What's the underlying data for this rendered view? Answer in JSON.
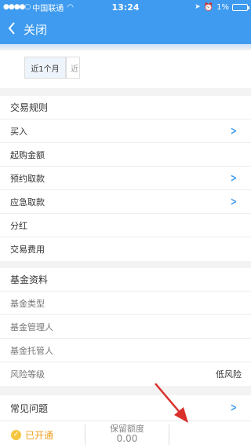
{
  "status_bar": {
    "carrier": "中国联通",
    "time": "13:24",
    "battery": "1%"
  },
  "nav": {
    "back_icon": "chevron-left-icon",
    "close_label": "关闭"
  },
  "tabs": {
    "active": "近1个月",
    "partial": "近"
  },
  "trade_rules": {
    "heading": "交易规则",
    "items": [
      {
        "label": "买入",
        "chevron": true
      },
      {
        "label": "起购金额",
        "chevron": false
      },
      {
        "label": "预约取款",
        "chevron": true
      },
      {
        "label": "应急取款",
        "chevron": true
      },
      {
        "label": "分红",
        "chevron": false
      },
      {
        "label": "交易费用",
        "chevron": false
      }
    ]
  },
  "fund_info": {
    "heading": "基金资料",
    "items": [
      {
        "label": "基金类型",
        "value": ""
      },
      {
        "label": "基金管理人",
        "value": ""
      },
      {
        "label": "基金托管人",
        "value": ""
      },
      {
        "label": "风险等级",
        "value": "低风险"
      }
    ]
  },
  "faq": {
    "label": "常见问题"
  },
  "bottom_bar": {
    "opened_label": "已开通",
    "quota_label": "保留额度",
    "quota_value": "0.00"
  },
  "colors": {
    "accent": "#3e9bf0",
    "opened": "#f0a020",
    "annotation_arrow": "#d9302c"
  }
}
